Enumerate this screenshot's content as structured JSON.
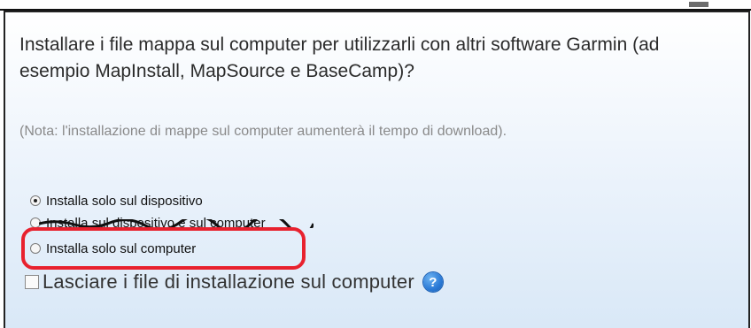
{
  "dialog": {
    "question": "Installare i file mappa sul computer per utilizzarli con altri software Garmin (ad esempio MapInstall, MapSource e BaseCamp)?",
    "note": "(Nota: l'installazione di mappe sul computer aumenterà il tempo di download).",
    "options": [
      {
        "label": "Installa solo sul dispositivo",
        "checked": true
      },
      {
        "label": "Installa sul dispositivo e sul computer",
        "checked": false
      },
      {
        "label": "Installa solo sul computer",
        "checked": false
      }
    ],
    "keep_files_label": "Lasciare i file di installazione sul computer",
    "help_glyph": "?",
    "help_icon": "help-icon",
    "highlight_color": "#e8212e"
  }
}
